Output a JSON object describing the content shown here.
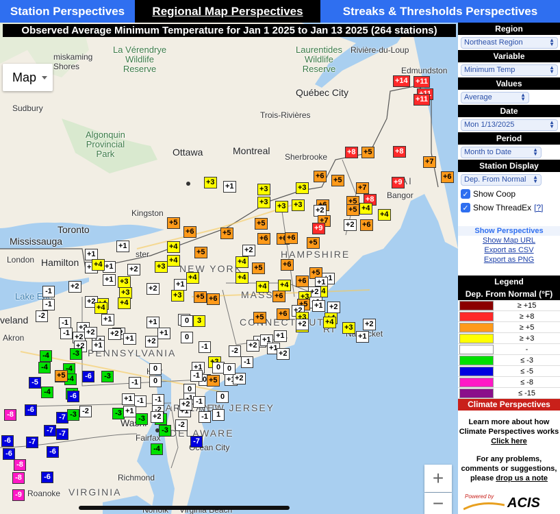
{
  "tabs": [
    {
      "label": "Station Perspectives"
    },
    {
      "label": "Regional Map Perspectives"
    },
    {
      "label": "Streaks & Thresholds Perspectives"
    }
  ],
  "map": {
    "title": "Observed Average Minimum Temperature for Jan 1 2025 to Jan 13 2025 (264 stations)",
    "type_label": "Map",
    "zoom_in": "+",
    "zoom_out": "−",
    "places": [
      {
        "t": "La Vérendrye\nWildlife\nReserve",
        "c": "park"
      },
      {
        "t": "Laurentides\nWildlife\nReserve",
        "c": "park"
      },
      {
        "t": "Algonquin\nProvincial\nPark",
        "c": "park"
      },
      {
        "t": "miskaming\nShores",
        "c": ""
      },
      {
        "t": "Rivière-du-Loup",
        "c": ""
      },
      {
        "t": "Edmundston",
        "c": ""
      },
      {
        "t": "Québec City",
        "c": "big"
      },
      {
        "t": "Sudbury",
        "c": ""
      },
      {
        "t": "Trois-Rivières",
        "c": ""
      },
      {
        "t": "Ottawa",
        "c": "big"
      },
      {
        "t": "Montreal",
        "c": "big"
      },
      {
        "t": "Sherbrooke",
        "c": ""
      },
      {
        "t": "Kingston",
        "c": ""
      },
      {
        "t": "Toronto",
        "c": "big"
      },
      {
        "t": "Mississauga",
        "c": "big"
      },
      {
        "t": "Hamilton",
        "c": "big"
      },
      {
        "t": "London",
        "c": ""
      },
      {
        "t": "Bangor",
        "c": ""
      },
      {
        "t": "NEW YORK",
        "c": "state"
      },
      {
        "t": "HAMPSHIRE",
        "c": "state"
      },
      {
        "t": "MASS",
        "c": "state"
      },
      {
        "t": "CONNECTICUT",
        "c": "state"
      },
      {
        "t": "RI",
        "c": "state"
      },
      {
        "t": "Nantucket",
        "c": ""
      },
      {
        "t": "veland",
        "c": "big"
      },
      {
        "t": "Akron",
        "c": ""
      },
      {
        "t": "PENNSYLVANIA",
        "c": "state"
      },
      {
        "t": "MARYLAND",
        "c": "state"
      },
      {
        "t": "NEW JERSEY",
        "c": "state"
      },
      {
        "t": "DELAWARE",
        "c": "state"
      },
      {
        "t": "Washi",
        "c": "big"
      },
      {
        "t": "Fairfax",
        "c": ""
      },
      {
        "t": "Ocean City",
        "c": ""
      },
      {
        "t": "Richmond",
        "c": ""
      },
      {
        "t": "VIRGINIA",
        "c": "state"
      },
      {
        "t": "Roanoke",
        "c": ""
      },
      {
        "t": "Norfolk",
        "c": ""
      },
      {
        "t": "Virginia Beach",
        "c": ""
      },
      {
        "t": "Lake Erie",
        "c": "water"
      },
      {
        "t": "MAI",
        "c": "state"
      },
      {
        "t": "ster",
        "c": ""
      },
      {
        "t": "Harr",
        "c": ""
      }
    ],
    "stations": [
      {
        "v": "+14",
        "c": "red"
      },
      {
        "v": "+11",
        "c": "red"
      },
      {
        "v": "+11",
        "c": "red"
      },
      {
        "v": "+11",
        "c": "red"
      },
      {
        "v": "+8",
        "c": "red"
      },
      {
        "v": "+5",
        "c": "orange"
      },
      {
        "v": "+8",
        "c": "red"
      },
      {
        "v": "+7",
        "c": "orange"
      },
      {
        "v": "+6",
        "c": "orange"
      },
      {
        "v": "+5",
        "c": "orange"
      },
      {
        "v": "+9",
        "c": "red"
      },
      {
        "v": "+6",
        "c": "orange"
      },
      {
        "v": "+3",
        "c": "yellow"
      },
      {
        "v": "+1",
        "c": "white"
      },
      {
        "v": "+3",
        "c": "yellow"
      },
      {
        "v": "+3",
        "c": "yellow"
      },
      {
        "v": "+7",
        "c": "orange"
      },
      {
        "v": "+8",
        "c": "red"
      },
      {
        "v": "+5",
        "c": "orange"
      },
      {
        "v": "+3",
        "c": "yellow"
      },
      {
        "v": "+3",
        "c": "yellow"
      },
      {
        "v": "+3",
        "c": "yellow"
      },
      {
        "v": "+6",
        "c": "orange"
      },
      {
        "v": "+2",
        "c": "white"
      },
      {
        "v": "+5",
        "c": "orange"
      },
      {
        "v": "+4",
        "c": "yellow"
      },
      {
        "v": "+4",
        "c": "yellow"
      },
      {
        "v": "+7",
        "c": "orange"
      },
      {
        "v": "+6",
        "c": "orange"
      },
      {
        "v": "+5",
        "c": "orange"
      },
      {
        "v": "+2",
        "c": "white"
      },
      {
        "v": "+9",
        "c": "red"
      },
      {
        "v": "+6",
        "c": "orange"
      },
      {
        "v": "+5",
        "c": "orange"
      },
      {
        "v": "+5",
        "c": "orange"
      },
      {
        "v": "+6",
        "c": "orange"
      },
      {
        "v": "+6",
        "c": "orange"
      },
      {
        "v": "+6",
        "c": "orange"
      },
      {
        "v": "+2",
        "c": "white"
      },
      {
        "v": "+5",
        "c": "orange"
      },
      {
        "v": "+4",
        "c": "yellow"
      },
      {
        "v": "+5",
        "c": "orange"
      },
      {
        "v": "+1",
        "c": "white"
      },
      {
        "v": "+1",
        "c": "white"
      },
      {
        "v": "+2",
        "c": "white"
      },
      {
        "v": "+4",
        "c": "yellow"
      },
      {
        "v": "+5",
        "c": "orange"
      },
      {
        "v": "+6",
        "c": "orange"
      },
      {
        "v": "+4",
        "c": "yellow"
      },
      {
        "v": "+1",
        "c": "white"
      },
      {
        "v": "+1",
        "c": "white"
      },
      {
        "v": "+3",
        "c": "yellow"
      },
      {
        "v": "+4",
        "c": "yellow"
      },
      {
        "v": "+2",
        "c": "white"
      },
      {
        "v": "+4",
        "c": "yellow"
      },
      {
        "v": "+5",
        "c": "orange"
      },
      {
        "v": "+6",
        "c": "orange"
      },
      {
        "v": "+3",
        "c": "yellow"
      },
      {
        "v": "+1",
        "c": "white"
      },
      {
        "v": "+1",
        "c": "white"
      },
      {
        "v": "+4",
        "c": "yellow"
      },
      {
        "v": "+2",
        "c": "white"
      },
      {
        "v": "+4",
        "c": "yellow"
      },
      {
        "v": "+4",
        "c": "yellow"
      },
      {
        "v": "+1",
        "c": "white"
      },
      {
        "v": "+3",
        "c": "yellow"
      },
      {
        "v": "+2",
        "c": "white"
      },
      {
        "v": "+3",
        "c": "yellow"
      },
      {
        "v": "+1",
        "c": "white"
      },
      {
        "v": "+4",
        "c": "yellow"
      },
      {
        "v": "+2",
        "c": "white"
      },
      {
        "v": "+5",
        "c": "orange"
      },
      {
        "v": "+6",
        "c": "orange"
      },
      {
        "v": "+6",
        "c": "orange"
      },
      {
        "v": "+3",
        "c": "yellow"
      },
      {
        "v": "+4",
        "c": "yellow"
      },
      {
        "v": "+2",
        "c": "white"
      },
      {
        "v": "+5",
        "c": "orange"
      },
      {
        "v": "+1",
        "c": "white"
      },
      {
        "v": "+2",
        "c": "white"
      },
      {
        "v": "+1",
        "c": "white"
      },
      {
        "v": "+1",
        "c": "white"
      },
      {
        "v": "0",
        "c": "white"
      },
      {
        "v": "+2",
        "c": "white"
      },
      {
        "v": "+1",
        "c": "white"
      },
      {
        "v": "+2",
        "c": "white"
      },
      {
        "v": "+1",
        "c": "white"
      },
      {
        "v": "+1",
        "c": "white"
      },
      {
        "v": "+1",
        "c": "white"
      },
      {
        "v": "+2",
        "c": "white"
      },
      {
        "v": "+1",
        "c": "white"
      },
      {
        "v": "+1",
        "c": "white"
      },
      {
        "v": "+2",
        "c": "white"
      },
      {
        "v": "+3",
        "c": "yellow"
      },
      {
        "v": "+4",
        "c": "yellow"
      },
      {
        "v": "+3",
        "c": "yellow"
      },
      {
        "v": "+2",
        "c": "white"
      },
      {
        "v": "+5",
        "c": "orange"
      },
      {
        "v": "+6",
        "c": "orange"
      },
      {
        "v": "+3",
        "c": "yellow"
      },
      {
        "v": "+4",
        "c": "yellow"
      },
      {
        "v": "+2",
        "c": "white"
      },
      {
        "v": "+1",
        "c": "white"
      },
      {
        "v": "+2",
        "c": "white"
      },
      {
        "v": "-1",
        "c": "white"
      },
      {
        "v": "-1",
        "c": "white"
      },
      {
        "v": "-2",
        "c": "white"
      },
      {
        "v": "-1",
        "c": "white"
      },
      {
        "v": "+2",
        "c": "white"
      },
      {
        "v": "+2",
        "c": "white"
      },
      {
        "v": "+4",
        "c": "yellow"
      },
      {
        "v": "+4",
        "c": "yellow"
      },
      {
        "v": "+1",
        "c": "white"
      },
      {
        "v": "+2",
        "c": "white"
      },
      {
        "v": "+1",
        "c": "white"
      },
      {
        "v": "-1",
        "c": "white"
      },
      {
        "v": "+2",
        "c": "white"
      },
      {
        "v": "+2",
        "c": "white"
      },
      {
        "v": "+1",
        "c": "white"
      },
      {
        "v": "0",
        "c": "white"
      },
      {
        "v": "3",
        "c": "yellow"
      },
      {
        "v": "0",
        "c": "white"
      },
      {
        "v": "-4",
        "c": "green"
      },
      {
        "v": "-3",
        "c": "green"
      },
      {
        "v": "-4",
        "c": "green"
      },
      {
        "v": "-4",
        "c": "green"
      },
      {
        "v": "-5",
        "c": "blue"
      },
      {
        "v": "-4",
        "c": "green"
      },
      {
        "v": "-6",
        "c": "blue"
      },
      {
        "v": "-3",
        "c": "green"
      },
      {
        "v": "-5",
        "c": "blue"
      },
      {
        "v": "-4",
        "c": "green"
      },
      {
        "v": "-4",
        "c": "green"
      },
      {
        "v": "-6",
        "c": "blue"
      },
      {
        "v": "-8",
        "c": "magenta"
      },
      {
        "v": "-6",
        "c": "blue"
      },
      {
        "v": "-7",
        "c": "blue"
      },
      {
        "v": "-3",
        "c": "green"
      },
      {
        "v": "-7",
        "c": "blue"
      },
      {
        "v": "-7",
        "c": "blue"
      },
      {
        "v": "-6",
        "c": "blue"
      },
      {
        "v": "-7",
        "c": "blue"
      },
      {
        "v": "-6",
        "c": "blue"
      },
      {
        "v": "-6",
        "c": "blue"
      },
      {
        "v": "-8",
        "c": "magenta"
      },
      {
        "v": "-8",
        "c": "magenta"
      },
      {
        "v": "-6",
        "c": "blue"
      },
      {
        "v": "-9",
        "c": "magenta"
      },
      {
        "v": "-2",
        "c": "white"
      },
      {
        "v": "-3",
        "c": "green"
      },
      {
        "v": "-3",
        "c": "green"
      },
      {
        "v": "-3",
        "c": "green"
      },
      {
        "v": "-2",
        "c": "white"
      },
      {
        "v": "-3",
        "c": "green"
      },
      {
        "v": "-4",
        "c": "green"
      },
      {
        "v": "-2",
        "c": "white"
      },
      {
        "v": "-7",
        "c": "blue"
      },
      {
        "v": "0",
        "c": "white"
      },
      {
        "v": "-1",
        "c": "white"
      },
      {
        "v": "0",
        "c": "white"
      },
      {
        "v": "+1",
        "c": "white"
      },
      {
        "v": "-1",
        "c": "white"
      },
      {
        "v": "-1",
        "c": "white"
      },
      {
        "v": "0",
        "c": "white"
      },
      {
        "v": "0",
        "c": "white"
      },
      {
        "v": "+1",
        "c": "white"
      },
      {
        "v": "+2",
        "c": "white"
      },
      {
        "v": "-1",
        "c": "white"
      },
      {
        "v": "-1",
        "c": "white"
      },
      {
        "v": "1",
        "c": "white"
      },
      {
        "v": "0",
        "c": "white"
      },
      {
        "v": "+5",
        "c": "orange"
      },
      {
        "v": "+1",
        "c": "white"
      },
      {
        "v": "+2",
        "c": "white"
      },
      {
        "v": "-1",
        "c": "white"
      },
      {
        "v": "+1",
        "c": "white"
      },
      {
        "v": "+2",
        "c": "white"
      },
      {
        "v": "+3",
        "c": "yellow"
      },
      {
        "v": "+1",
        "c": "white"
      },
      {
        "v": "0",
        "c": "white"
      },
      {
        "v": "0",
        "c": "white"
      },
      {
        "v": "-1",
        "c": "white"
      },
      {
        "v": "-2",
        "c": "white"
      },
      {
        "v": "-1",
        "c": "white"
      },
      {
        "v": "-1",
        "c": "white"
      },
      {
        "v": "+5",
        "c": "orange"
      },
      {
        "v": "+1",
        "c": "white"
      },
      {
        "v": "+2",
        "c": "white"
      },
      {
        "v": "0",
        "c": "white"
      },
      {
        "v": "+1",
        "c": "white"
      },
      {
        "v": "-5",
        "c": "blue"
      }
    ]
  },
  "sidebar": {
    "region_head": "Region",
    "region_value": "Northeast Region",
    "variable_head": "Variable",
    "variable_value": "Minimum Temp",
    "values_head": "Values",
    "values_value": "Average",
    "date_head": "Date",
    "date_value": "Mon 1/13/2025",
    "period_head": "Period",
    "period_value": "Month to Date",
    "display_head": "Station Display",
    "display_value": "Dep. From Normal",
    "show_coop": "Show Coop",
    "show_threadex": "Show ThreadEx",
    "threadex_help": "[?]",
    "show_perspectives": "Show Perspectives",
    "show_map_url": "Show Map URL",
    "export_csv": "Export as CSV",
    "export_png": "Export as PNG",
    "legend_head": "Legend",
    "legend_sub": "Dep. From Normal (°F)",
    "legend": [
      {
        "label": "≥ +15",
        "color": "#8b0000"
      },
      {
        "label": "≥ +8",
        "color": "#ff2a2a"
      },
      {
        "label": "≥ +5",
        "color": "#ff9a1a"
      },
      {
        "label": "≥ +3",
        "color": "#ffff00"
      },
      {
        "label": "-",
        "color": "#ffffff"
      },
      {
        "label": "≤ -3",
        "color": "#00e000"
      },
      {
        "label": "≤ -5",
        "color": "#0000e0"
      },
      {
        "label": "≤ -8",
        "color": "#ff1ac6"
      },
      {
        "label": "≤ -15",
        "color": "#8a0f8a"
      }
    ],
    "cp_head": "Climate Perspectives",
    "learn_text": "Learn more about how Climate Perspectives works",
    "click_here": "Click here",
    "problems_text": "For any problems, comments or suggestions, please",
    "drop_note": "drop us a note",
    "powered_by": "Powered by",
    "acis": "ACIS"
  },
  "colors": {
    "red": "#ff2a2a",
    "orange": "#ff9a1a",
    "yellow": "#ffff00",
    "white": "#ffffff",
    "green": "#00e000",
    "blue": "#0000e0",
    "magenta": "#ff1ac6",
    "tab_blue": "#2f6ff0"
  }
}
